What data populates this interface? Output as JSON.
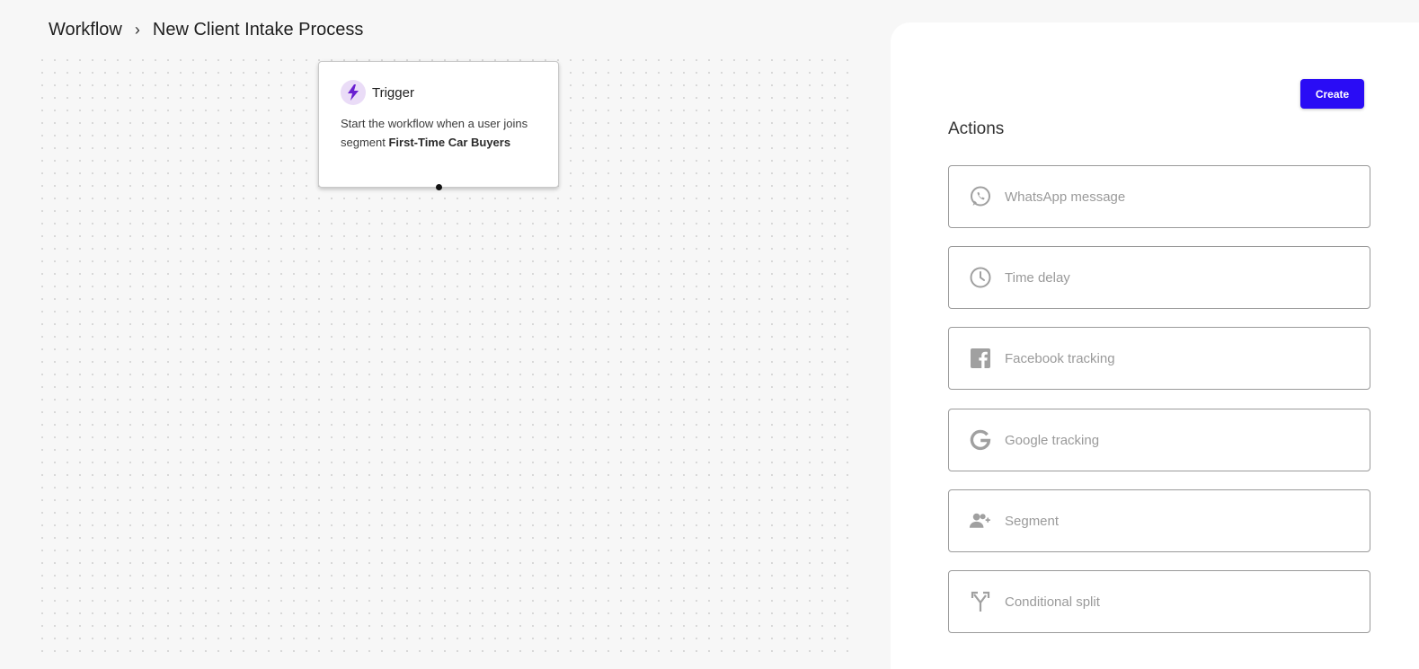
{
  "breadcrumb": {
    "root": "Workflow",
    "separator": "›",
    "current": "New Client Intake Process"
  },
  "trigger": {
    "title": "Trigger",
    "desc_prefix": "Start the workflow when a user joins segment ",
    "segment_name": "First-Time Car Buyers",
    "icon": "bolt-icon"
  },
  "panel": {
    "create_label": "Create",
    "actions_title": "Actions",
    "actions": [
      {
        "label": "WhatsApp message",
        "icon": "whatsapp-icon"
      },
      {
        "label": "Time delay",
        "icon": "clock-icon"
      },
      {
        "label": "Facebook tracking",
        "icon": "facebook-icon"
      },
      {
        "label": "Google tracking",
        "icon": "google-icon"
      },
      {
        "label": "Segment",
        "icon": "add-user-icon"
      },
      {
        "label": "Conditional split",
        "icon": "split-icon"
      }
    ]
  },
  "colors": {
    "accent": "#2a0cf5",
    "trigger_icon": "#6a1fd1",
    "trigger_icon_bg": "#eadcf7",
    "action_text": "#9a9a9a"
  }
}
